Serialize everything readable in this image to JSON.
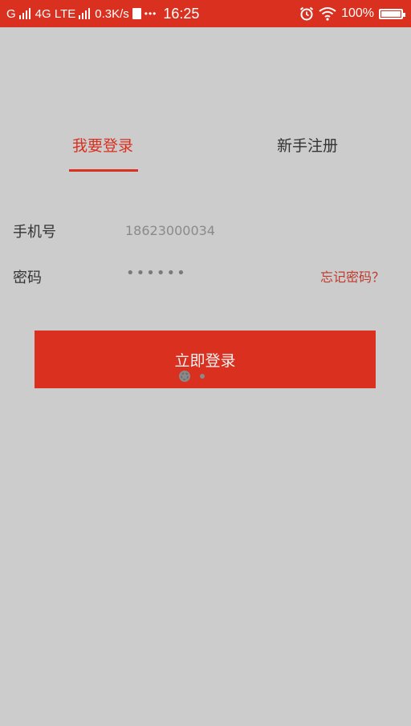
{
  "status_bar": {
    "carrier1": "G",
    "network": "4G LTE",
    "speed": "0.3K/s",
    "time": "16:25",
    "battery_pct": "100%",
    "dots": "•••"
  },
  "tabs": [
    {
      "label": "我要登录",
      "active": true
    },
    {
      "label": "新手注册",
      "active": false
    }
  ],
  "form": {
    "phone_label": "手机号",
    "phone_value": "18623000034",
    "password_label": "密码",
    "password_value": "••••••",
    "forgot_label": "忘记密码？"
  },
  "login_button": "立即登录",
  "colors": {
    "accent": "#d9301f",
    "background": "#cccccc"
  }
}
